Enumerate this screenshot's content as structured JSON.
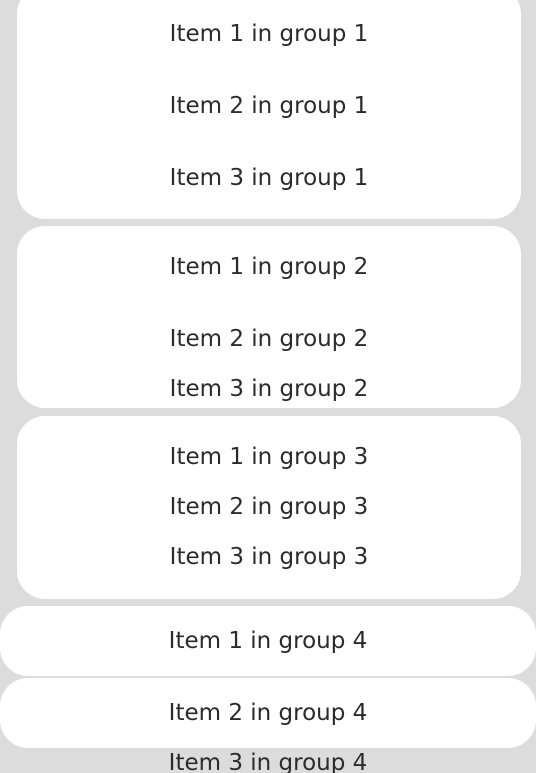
{
  "groups": [
    {
      "items": [
        "Item 1 in group 1",
        "Item 2 in group 1",
        "Item 3 in group 1"
      ]
    },
    {
      "items": [
        "Item 1 in group 2",
        "Item 2 in group 2",
        "Item 3 in group 2"
      ]
    },
    {
      "items": [
        "Item 1 in group 3",
        "Item 2 in group 3",
        "Item 3 in group 3"
      ]
    },
    {
      "items": [
        "Item 1 in group 4",
        "Item 2 in group 4",
        "Item 3 in group 4"
      ]
    }
  ],
  "colors": {
    "background": "#dcdcdc",
    "card": "#ffffff",
    "text": "#2b2b2b"
  }
}
